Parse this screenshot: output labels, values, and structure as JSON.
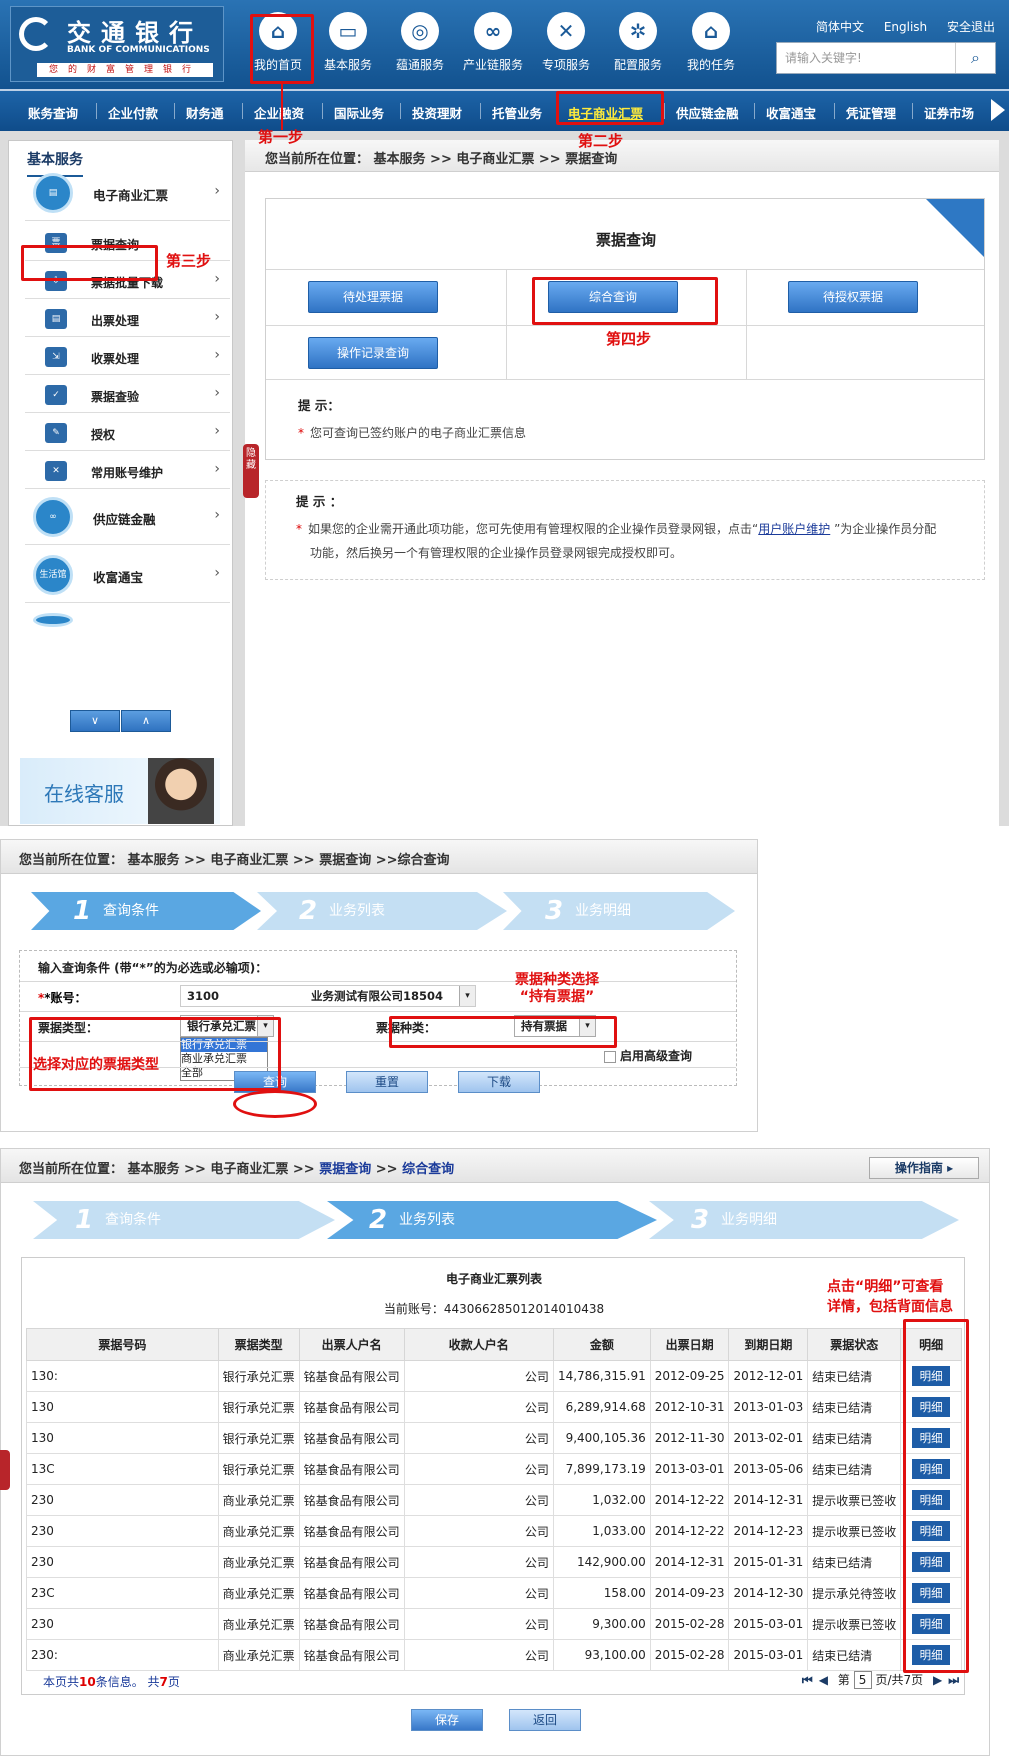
{
  "section1": {
    "logo": {
      "cn": "交通银行",
      "en": "BANK OF COMMUNICATIONS",
      "slogan": "您的财富管理银行"
    },
    "topnav": [
      {
        "label": "我的首页",
        "icon": "home-icon",
        "glyph": "⌂"
      },
      {
        "label": "基本服务",
        "icon": "monitor-icon",
        "glyph": "▭"
      },
      {
        "label": "蕴通服务",
        "icon": "swirl-icon",
        "glyph": "◎"
      },
      {
        "label": "产业链服务",
        "icon": "link-icon",
        "glyph": "∞"
      },
      {
        "label": "专项服务",
        "icon": "tools-icon",
        "glyph": "✕"
      },
      {
        "label": "配置服务",
        "icon": "gear-icon",
        "glyph": "✲"
      },
      {
        "label": "我的任务",
        "icon": "house-icon",
        "glyph": "⌂"
      }
    ],
    "toplinks": {
      "lang_cn": "简体中文",
      "lang_en": "English",
      "logout": "安全退出"
    },
    "search": {
      "placeholder": "请输入关键字!"
    },
    "menu": [
      "账务查询",
      "企业付款",
      "财务通",
      "企业融资",
      "国际业务",
      "投资理财",
      "托管业务",
      "电子商业汇票",
      "供应链金融",
      "收富通宝",
      "凭证管理",
      "证券市场"
    ],
    "sidebar": {
      "title": "基本服务",
      "big_items": [
        {
          "label": "电子商业汇票",
          "icon": "bill-icon"
        },
        {
          "label": "供应链金融",
          "icon": "chain-icon"
        },
        {
          "label": "收富通宝",
          "icon": "life-icon",
          "badge": "生活馆"
        }
      ],
      "small_items": [
        {
          "label": "票据查询",
          "icon": "bill-query-icon"
        },
        {
          "label": "票据批量下载",
          "icon": "download-icon"
        },
        {
          "label": "出票处理",
          "icon": "printer-icon"
        },
        {
          "label": "收票处理",
          "icon": "receive-icon"
        },
        {
          "label": "票据查验",
          "icon": "verify-icon"
        },
        {
          "label": "授权",
          "icon": "authorize-icon"
        },
        {
          "label": "常用账号维护",
          "icon": "wrench-icon"
        }
      ],
      "service": "在线客服"
    },
    "hide_tab": "隐藏",
    "breadcrumb": "您当前所在位置： 基本服务 >> 电子商业汇票 >> 票据查询",
    "panel_title": "票据查询",
    "buttons": [
      "待处理票据",
      "综合查询",
      "待授权票据",
      "操作记录查询"
    ],
    "tip1_title": "提 示：",
    "tip1": "您可查询已签约账户的电子商业汇票信息",
    "tip2_title": "提 示 ：",
    "tip2_line1a": "如果您的企业需开通此项功能，您可先使用有管理权限的企业操作员登录网银，点击“",
    "tip2_link": "用户账户维护",
    "tip2_line1b": " ”为企业操作员分配",
    "tip2_line2": "功能，然后换另一个有管理权限的企业操作员登录网银完成授权即可。",
    "steps": [
      "第一步",
      "第二步",
      "第三步",
      "第四步"
    ]
  },
  "section2": {
    "breadcrumb": "您当前所在位置： 基本服务 >> 电子商业汇票 >> 票据查询 >>综合查询",
    "steps": [
      {
        "n": "1",
        "label": "查询条件"
      },
      {
        "n": "2",
        "label": "业务列表"
      },
      {
        "n": "3",
        "label": "业务明细"
      }
    ],
    "form_title": "输入查询条件 (带“*”的为必选或必输项)：",
    "account_label": "*账号：",
    "account_value": "3100",
    "account_name": "业务测试有限公司18504",
    "type_label": "票据类型：",
    "type_value": "银行承兑汇票",
    "type_options": [
      "银行承兑汇票",
      "商业承兑汇票",
      "全部"
    ],
    "kind_label": "票据种类：",
    "kind_value": "持有票据",
    "advanced": "启用高级查询",
    "buttons": [
      "查询",
      "重置",
      "下载"
    ],
    "note_kind": "票据种类选择\n“持有票据”",
    "note_type": "选择对应的票据类型"
  },
  "section3": {
    "breadcrumb_prefix": "您当前所在位置： 基本服务 >> 电子商业汇票 >> ",
    "breadcrumb_link1": "票据查询",
    "breadcrumb_mid": " >> ",
    "breadcrumb_link2": "综合查询",
    "guide": "操作指南 ▸",
    "steps": [
      {
        "n": "1",
        "label": "查询条件"
      },
      {
        "n": "2",
        "label": "业务列表"
      },
      {
        "n": "3",
        "label": "业务明细"
      }
    ],
    "table_title": "电子商业汇票列表",
    "account_line": "当前账号：443066285012014010438",
    "columns": [
      "票据号码",
      "票据类型",
      "出票人户名",
      "收款人户名",
      "金额",
      "出票日期",
      "到期日期",
      "票据状态",
      "明细"
    ],
    "rows": [
      [
        "130:",
        "银行承兑汇票",
        "铭基食品有限公司",
        "公司",
        "14,786,315.91",
        "2012-09-25",
        "2012-12-01",
        "结束已结清",
        "明细"
      ],
      [
        "130",
        "银行承兑汇票",
        "铭基食品有限公司",
        "公司",
        "6,289,914.68",
        "2012-10-31",
        "2013-01-03",
        "结束已结清",
        "明细"
      ],
      [
        "130",
        "银行承兑汇票",
        "铭基食品有限公司",
        "公司",
        "9,400,105.36",
        "2012-11-30",
        "2013-02-01",
        "结束已结清",
        "明细"
      ],
      [
        "13C",
        "银行承兑汇票",
        "铭基食品有限公司",
        "公司",
        "7,899,173.19",
        "2013-03-01",
        "2013-05-06",
        "结束已结清",
        "明细"
      ],
      [
        "230",
        "商业承兑汇票",
        "铭基食品有限公司",
        "公司",
        "1,032.00",
        "2014-12-22",
        "2014-12-31",
        "提示收票已签收",
        "明细"
      ],
      [
        "230",
        "商业承兑汇票",
        "铭基食品有限公司",
        "公司",
        "1,033.00",
        "2014-12-22",
        "2014-12-23",
        "提示收票已签收",
        "明细"
      ],
      [
        "230",
        "商业承兑汇票",
        "铭基食品有限公司",
        "公司",
        "142,900.00",
        "2014-12-31",
        "2015-01-31",
        "结束已结清",
        "明细"
      ],
      [
        "23C",
        "商业承兑汇票",
        "铭基食品有限公司",
        "公司",
        "158.00",
        "2014-09-23",
        "2014-12-30",
        "提示承兑待签收",
        "明细"
      ],
      [
        "230",
        "商业承兑汇票",
        "铭基食品有限公司",
        "公司",
        "9,300.00",
        "2015-02-28",
        "2015-03-01",
        "提示收票已签收",
        "明细"
      ],
      [
        "230:",
        "商业承兑汇票",
        "铭基食品有限公司",
        "公司",
        "93,100.00",
        "2015-02-28",
        "2015-03-01",
        "结束已结清",
        "明细"
      ]
    ],
    "footer_a": "本页共",
    "footer_count": "10",
    "footer_b": "条信息。 共",
    "footer_pages": "7",
    "footer_c": "页",
    "pager_page": "5",
    "pager_prefix": "第",
    "pager_suffix": "页/共7页",
    "buttons": [
      "保存",
      "返回"
    ],
    "note_detail": "点击“明细”可查看\n详情，包括背面信息"
  }
}
